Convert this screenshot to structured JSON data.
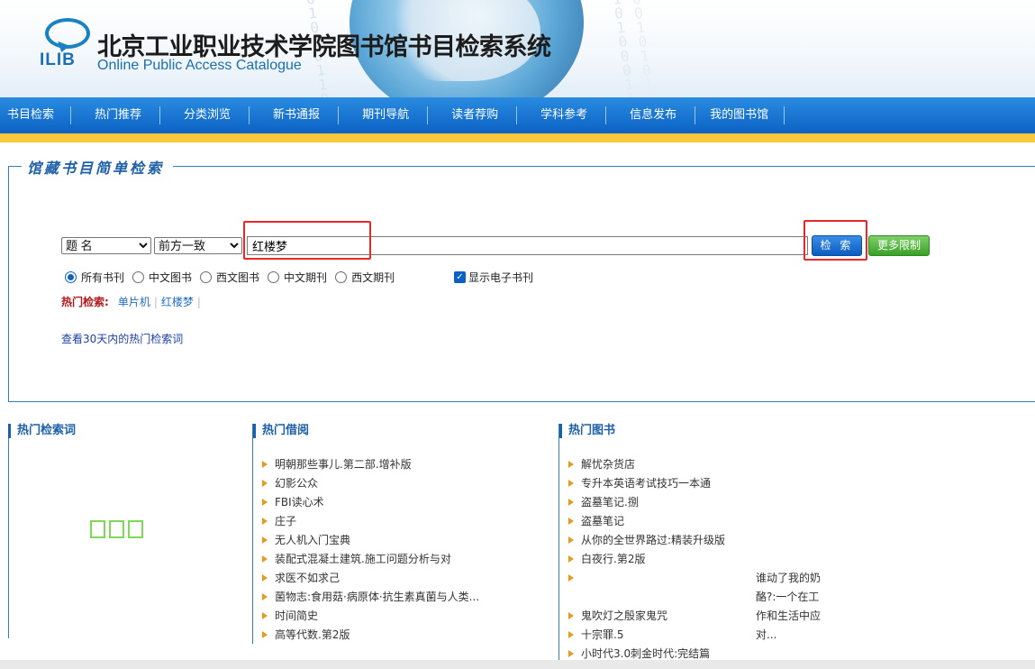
{
  "header": {
    "logo_text": "ILIB",
    "title": "北京工业职业技术学院图书馆书目检索系统",
    "subtitle": "Online Public Access Catalogue"
  },
  "nav": {
    "items": [
      "书目检索",
      "热门推荐",
      "分类浏览",
      "新书通报",
      "期刊导航",
      "读者荐购",
      "学科参考",
      "信息发布",
      "我的图书馆"
    ]
  },
  "search": {
    "legend": "馆藏书目简单检索",
    "field_options": [
      "题  名"
    ],
    "field_selected": "题  名",
    "mode_options": [
      "前方一致"
    ],
    "mode_selected": "前方一致",
    "keyword_value": "红楼梦",
    "search_button": "检 索",
    "more_button": "更多限制",
    "scopes": [
      "所有书刊",
      "中文图书",
      "西文图书",
      "中文期刊",
      "西文期刊"
    ],
    "scope_selected": "所有书刊",
    "show_ebook_label": "显示电子书刊",
    "show_ebook_checked": true,
    "hot_label": "热门检索:",
    "hot_terms": [
      "单片机",
      "红楼梦"
    ],
    "view_30_days": "查看30天内的热门检索词"
  },
  "columns": {
    "hot_search_title": "热门检索词",
    "hot_borrow_title": "热门借阅",
    "hot_borrow": [
      "明朝那些事儿.第二部.增补版",
      "幻影公众",
      "FBI读心术",
      "庄子",
      "无人机入门宝典",
      "装配式混凝土建筑.施工问题分析与对",
      "求医不如求己",
      "菌物志:食用菇·病原体·抗生素真菌与人类...",
      "时间简史",
      "高等代数.第2版"
    ],
    "hot_books_title": "热门图书",
    "hot_books": [
      "解忧杂货店",
      "专升本英语考试技巧一本通",
      "盗墓笔记.捌",
      "盗墓笔记",
      "从你的全世界路过:精装升级版",
      "白夜行.第2版",
      "谁动了我的奶酪?:一个在工作和生活中应对...",
      "鬼吹灯之殷家鬼咒",
      "十宗罪.5",
      "小时代3.0刺金时代:完结篇"
    ]
  },
  "colors": {
    "nav_blue": "#0b62c4",
    "accent_yellow": "#f8c73a",
    "highlight_red": "#e8282a",
    "more_green": "#3aa026"
  }
}
